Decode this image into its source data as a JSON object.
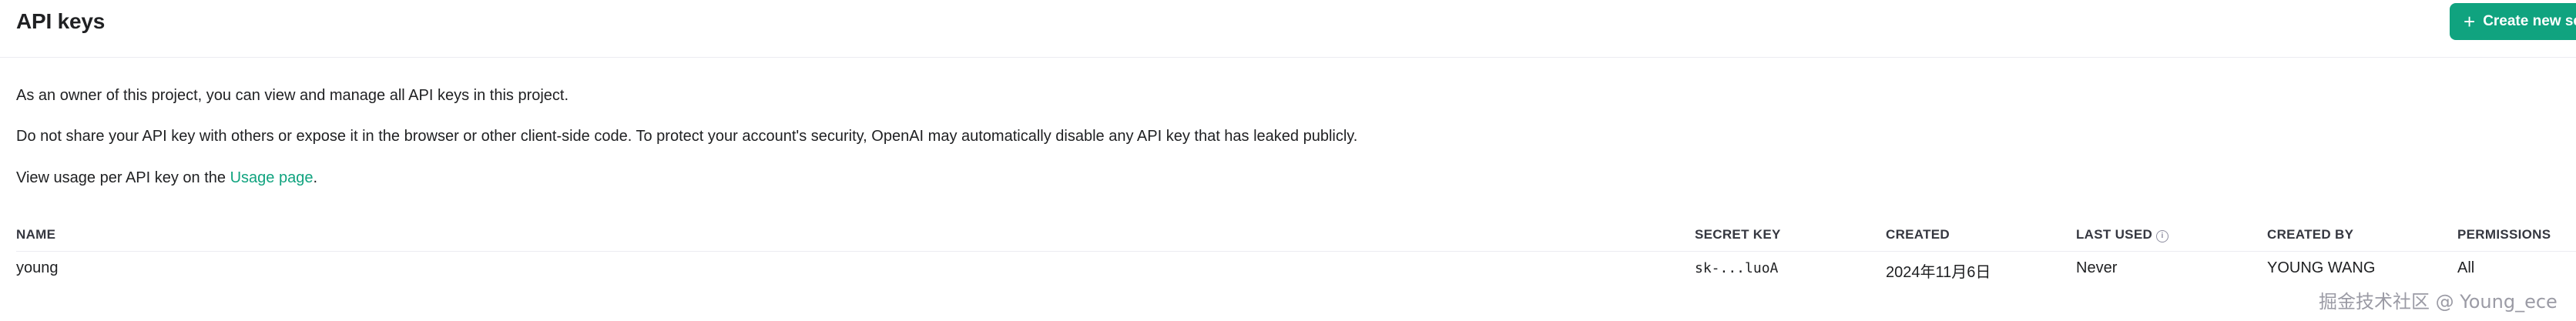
{
  "header": {
    "title": "API keys",
    "create_button_label": "Create new secret key"
  },
  "description": {
    "line1": "As an owner of this project, you can view and manage all API keys in this project.",
    "line2": "Do not share your API key with others or expose it in the browser or other client-side code. To protect your account's security, OpenAI may automatically disable any API key that has leaked publicly.",
    "line3_prefix": "View usage per API key on the ",
    "line3_link": "Usage page",
    "line3_suffix": "."
  },
  "table": {
    "headers": {
      "name": "NAME",
      "secret_key": "SECRET KEY",
      "created": "CREATED",
      "last_used": "LAST USED",
      "created_by": "CREATED BY",
      "permissions": "PERMISSIONS"
    },
    "rows": [
      {
        "name": "young",
        "secret_key": "sk-...luoA",
        "created": "2024年11月6日",
        "last_used": "Never",
        "created_by": "YOUNG WANG",
        "permissions": "All"
      }
    ]
  },
  "watermark": "掘金技术社区 @ Young_ece",
  "colors": {
    "accent": "#10a37f",
    "text": "#202123",
    "divider": "#ececf1"
  },
  "icons": {
    "create_button": "plus-icon",
    "last_used_header": "info-icon"
  }
}
